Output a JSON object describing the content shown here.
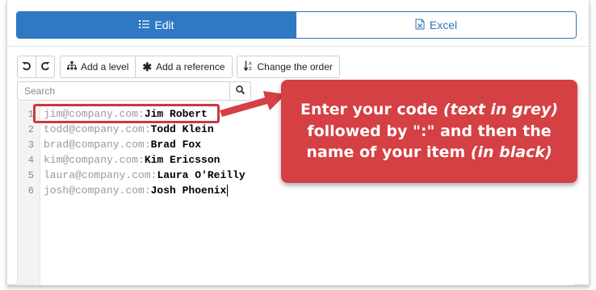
{
  "tabs": [
    {
      "label": "Edit",
      "active": true,
      "icon": "list-icon"
    },
    {
      "label": "Excel",
      "active": false,
      "icon": "excel-file-icon"
    }
  ],
  "toolbar": {
    "undo_icon": "undo-icon",
    "redo_icon": "redo-icon",
    "add_level": "Add a level",
    "add_reference": "Add a reference",
    "change_order": "Change the order"
  },
  "search": {
    "placeholder": "Search",
    "value": ""
  },
  "editor": {
    "lines": [
      {
        "num": "1",
        "code": "jim@company.com:",
        "name": "Jim Robert"
      },
      {
        "num": "2",
        "code": "todd@company.com:",
        "name": "Todd Klein"
      },
      {
        "num": "3",
        "code": "brad@company.com:",
        "name": "Brad Fox"
      },
      {
        "num": "4",
        "code": "kim@company.com:",
        "name": "Kim Ericsson"
      },
      {
        "num": "5",
        "code": "laura@company.com:",
        "name": "Laura O'Reilly"
      },
      {
        "num": "6",
        "code": "josh@company.com:",
        "name": "Josh Phoenix"
      }
    ]
  },
  "callout": {
    "part1": "Enter your code ",
    "part2": "(text in grey)",
    "part3": " followed by \":\" and then the name of your item ",
    "part4": "(in black)"
  },
  "colors": {
    "primary": "#2f79c4",
    "callout": "#d44043",
    "code_grey": "#9a9a9a"
  }
}
